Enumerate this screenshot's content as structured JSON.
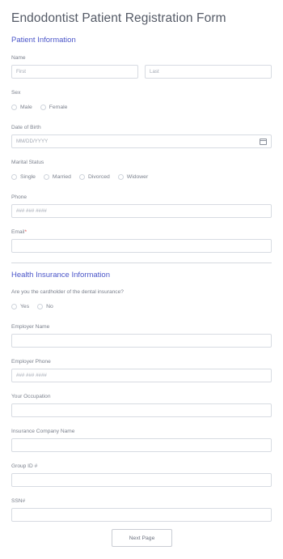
{
  "form_title": "Endodontist Patient Registration Form",
  "patient_section": {
    "title": "Patient Information",
    "name_label": "Name",
    "first_placeholder": "First",
    "last_placeholder": "Last",
    "sex_label": "Sex",
    "sex_options": [
      "Male",
      "Female"
    ],
    "dob_label": "Date of Birth",
    "dob_placeholder": "MM/DD/YYYY",
    "marital_label": "Marital Status",
    "marital_options": [
      "Single",
      "Married",
      "Divorced",
      "Widower"
    ],
    "phone_label": "Phone",
    "phone_placeholder": "### ### ####",
    "email_label": "Email",
    "email_required_mark": "*"
  },
  "insurance_section": {
    "title": "Health Insurance Information",
    "cardholder_label": "Are you the cardholder of the dental insurance?",
    "cardholder_options": [
      "Yes",
      "No"
    ],
    "employer_name_label": "Employer Name",
    "employer_phone_label": "Employer Phone",
    "employer_phone_placeholder": "### ### ####",
    "occupation_label": "Your Occupation",
    "insurance_company_label": "Insurance Company Name",
    "group_id_label": "Group ID #",
    "ssn_label": "SSN#"
  },
  "next_button_label": "Next Page",
  "colors": {
    "section_title": "#4b56c9",
    "required": "#e04a4a",
    "input_border": "#d7dbe2"
  },
  "icons": {
    "date_picker": "calendar-icon"
  }
}
